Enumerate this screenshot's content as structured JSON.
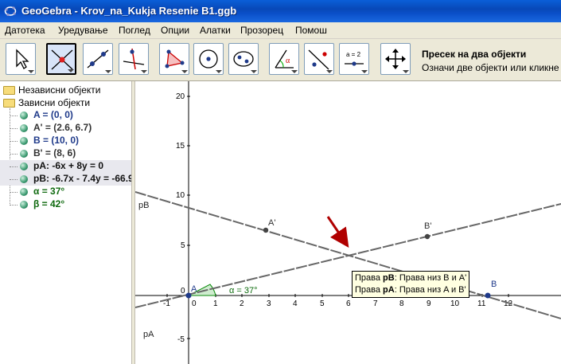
{
  "window": {
    "title": "GeoGebra - Krov_na_Kukja Resenie B1.ggb"
  },
  "menu": [
    "Датотека",
    "Уредување",
    "Поглед",
    "Опции",
    "Алатки",
    "Прозорец",
    "Помош"
  ],
  "toolbar": {
    "selected_tool": "intersect-two-objects",
    "info_title": "Пресек на два објекти",
    "info_help": "Означи две објекти или кликне"
  },
  "algebra": {
    "free_folder": "Независни објекти",
    "dependent_folder": "Зависни објекти",
    "objects": [
      {
        "text": "A = (0, 0)",
        "color": "#1f3a8a"
      },
      {
        "text": "A' = (2.6, 6.7)",
        "color": "#333333"
      },
      {
        "text": "B = (10, 0)",
        "color": "#1f3a8a"
      },
      {
        "text": "B' = (8, 6)",
        "color": "#333333"
      },
      {
        "text": "pA: -6x + 8y = 0",
        "color": "#111111"
      },
      {
        "text": "pB: -6.7x - 7.4y = -66.9",
        "color": "#111111"
      },
      {
        "text": "α = 37°",
        "color": "#0f6a0f"
      },
      {
        "text": "β = 42°",
        "color": "#0f6a0f"
      }
    ]
  },
  "graphics": {
    "x_ticks": [
      "-1",
      "0",
      "1",
      "2",
      "3",
      "4",
      "5",
      "6",
      "7",
      "8",
      "9",
      "10",
      "11",
      "12"
    ],
    "y_ticks": [
      "20",
      "15",
      "10",
      "5",
      "0",
      "-5"
    ],
    "point_labels": {
      "A": "A",
      "A_prime": "A'",
      "B": "B",
      "B_prime": "B'"
    },
    "line_labels": {
      "pA": "pA",
      "pB": "pB"
    },
    "angle_label": "α = 37°",
    "tooltip": {
      "line1_pre": "Права ",
      "line1_bold": "pB",
      "line1_post": ": Права низ B и A'",
      "line2_pre": "Права ",
      "line2_bold": "pA",
      "line2_post": ": Права низ A и B'"
    }
  }
}
